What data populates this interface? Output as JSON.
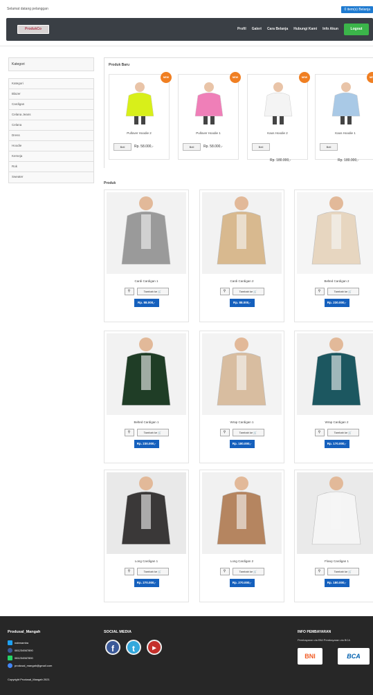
{
  "topbar": {
    "welcome": "Selamat datang pelanggan",
    "cart": "0 item(s) Belanja"
  },
  "logo": {
    "text": "ProdukCo"
  },
  "nav": {
    "items": [
      "Profil",
      "Galeri",
      "Cara Belanja",
      "Hubungi Kami",
      "Info Akun"
    ],
    "logout": "Logout"
  },
  "sidebar": {
    "header": "Kategori",
    "categories": [
      "Kategori",
      "Blazer",
      "Cardigan",
      "Celana Jeans",
      "Celana",
      "Dress",
      "Hoodie",
      "Kemeja",
      "Rok",
      "Sweater"
    ]
  },
  "new_section": {
    "title": "Produk Baru",
    "badge": "NEW",
    "buy_label": "Beli",
    "items": [
      {
        "name": "Pullover Hoodie 2",
        "price": "Rp. 58.000,-",
        "color": "#d8ef1a"
      },
      {
        "name": "Pullover Hoodie 1",
        "price": "Rp. 58.000,-",
        "color": "#ef7fb8"
      },
      {
        "name": "Kaos Hoodie 2",
        "price": "Rp. 180.000,-",
        "color": "#f4f4f4"
      },
      {
        "name": "Kaos Hoodie 1",
        "price": "Rp. 180.000,-",
        "color": "#a9c9e6"
      }
    ]
  },
  "product_section": {
    "title": "Produk",
    "cart_label": "Tambah ke",
    "items": [
      {
        "name": "Cardi Cardigan 1",
        "price": "Rp. 88.000,-",
        "bg": "#f2f2f2",
        "color": "#9a9a9a"
      },
      {
        "name": "Cardi Cardigan 2",
        "price": "Rp. 88.000,-",
        "bg": "#f2f2f2",
        "color": "#d8b98f"
      },
      {
        "name": "Belted Cardigan 2",
        "price": "Rp. 230.000,-",
        "bg": "#f5f5f5",
        "color": "#e7d6c0"
      },
      {
        "name": "Belted Cardigan 1",
        "price": "Rp. 230.000,-",
        "bg": "#f2f2f2",
        "color": "#1f3d26"
      },
      {
        "name": "Wrap Cardigan 1",
        "price": "Rp. 180.000,-",
        "bg": "#f3f3f3",
        "color": "#d8bda0"
      },
      {
        "name": "Wrap Cardigan 2",
        "price": "Rp. 170.000,-",
        "bg": "#f1f1f1",
        "color": "#1c5760"
      },
      {
        "name": "Long Cardigan 1",
        "price": "Rp. 270.000,-",
        "bg": "#e9e9e9",
        "color": "#3a3838"
      },
      {
        "name": "Long Cardigan 2",
        "price": "Rp. 270.000,-",
        "bg": "#f1f1f1",
        "color": "#b58560"
      },
      {
        "name": "Flowy Cardigan 1",
        "price": "Rp. 180.000,-",
        "bg": "#eaeaea",
        "color": "#f5f5f5"
      }
    ]
  },
  "footer": {
    "brand": "Produsal_Mangah",
    "contacts": [
      {
        "text": "nabmamba",
        "icon": "twitter-icon",
        "color": "#1da1f2"
      },
      {
        "text": "081234567890",
        "icon": "facebook-icon",
        "color": "#3b5998"
      },
      {
        "text": "081234567890",
        "icon": "whatsapp-icon",
        "color": "#25d366"
      },
      {
        "text": "produsal_mangah@gmail.com",
        "icon": "mail-icon",
        "color": "#4285f4"
      }
    ],
    "copyright": "Copyright Produsal_Mangah 2021",
    "social_title": "SOCIAL MEDIA",
    "pay_title": "INFO PEMBAYARAN",
    "pay_sub": "Pembayaran via BNI   Pembayaran via BCA",
    "banks": [
      "BNI",
      "BCA"
    ]
  }
}
